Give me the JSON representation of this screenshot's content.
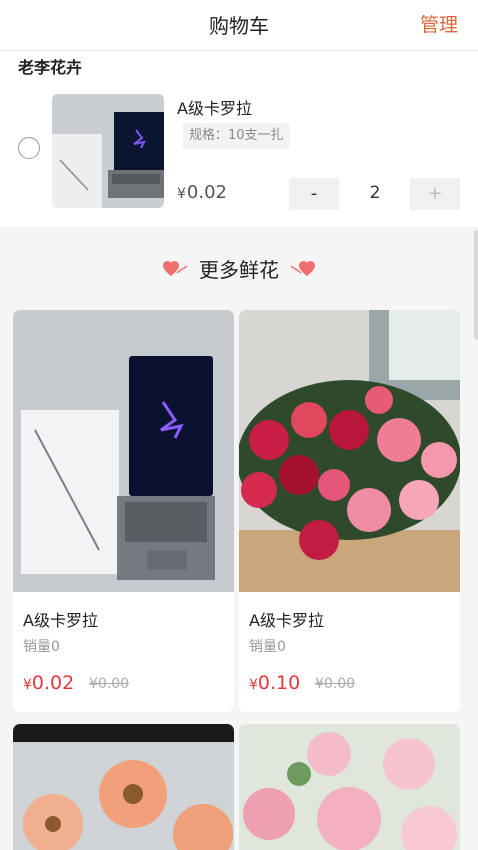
{
  "header": {
    "title": "购物车",
    "manage_label": "管理"
  },
  "cart": {
    "shop_name": "老李花卉",
    "item": {
      "name": "A级卡罗拉",
      "spec": "规格：10支一扎",
      "currency": "¥",
      "price": "0.02",
      "minus_label": "-",
      "quantity": "2",
      "plus_label": "+"
    }
  },
  "more": {
    "title": "更多鲜花"
  },
  "products": [
    {
      "name": "A级卡罗拉",
      "sales": "销量0",
      "currency": "¥",
      "price": "0.02",
      "original": "¥0.00"
    },
    {
      "name": "A级卡罗拉",
      "sales": "销量0",
      "currency": "¥",
      "price": "0.10",
      "original": "¥0.00"
    }
  ],
  "colors": {
    "accent": "#e0683b",
    "price_red": "#e23a3a",
    "heart": "#f06e6e"
  },
  "icons": {
    "heart": "heart-icon",
    "checkbox": "radio-circle"
  }
}
